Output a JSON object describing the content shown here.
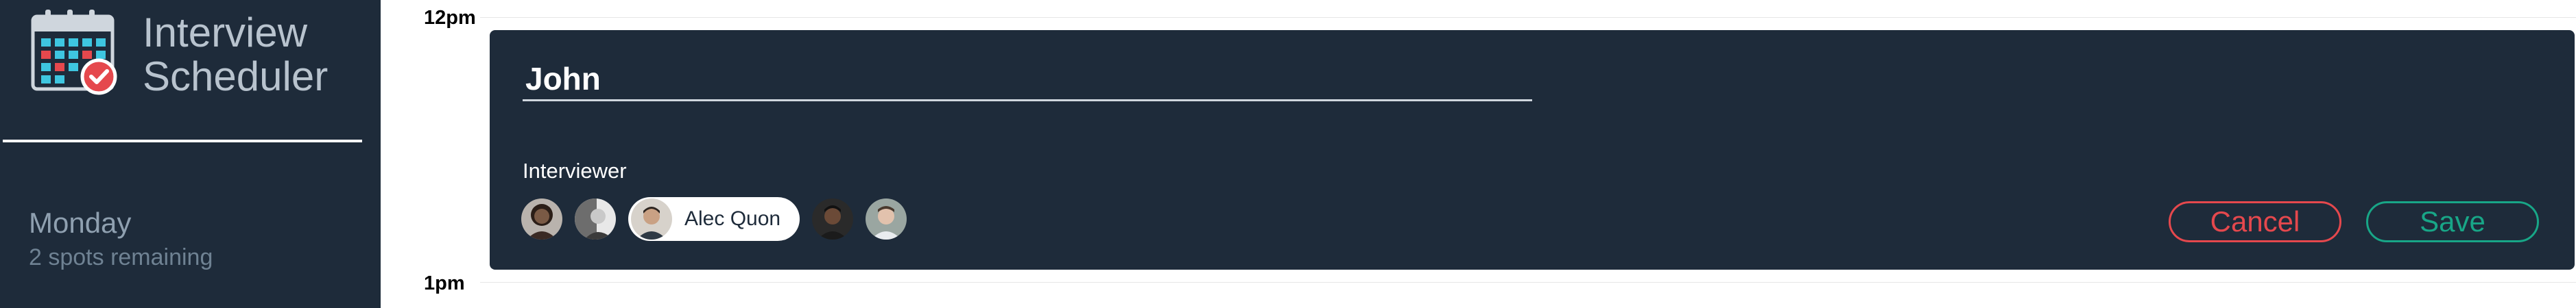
{
  "sidebar": {
    "logo_icon": "calendar-check-icon",
    "app_title_line1": "Interview",
    "app_title_line2": "Scheduler",
    "day": "Monday",
    "spots": "2 spots remaining"
  },
  "timeline": {
    "start_label": "12pm",
    "end_label": "1pm"
  },
  "card": {
    "name_value": "John",
    "interviewer_label": "Interviewer",
    "interviewers": [
      {
        "icon": "avatar-icon"
      },
      {
        "icon": "avatar-icon"
      },
      {
        "icon": "avatar-icon",
        "name": "Alec Quon",
        "selected": true
      },
      {
        "icon": "avatar-icon"
      },
      {
        "icon": "avatar-icon"
      }
    ],
    "cancel_label": "Cancel",
    "save_label": "Save"
  },
  "colors": {
    "sidebar_bg": "#1e2b3a",
    "card_bg": "#1e2b3a",
    "cancel": "#e5484d",
    "save": "#18a687"
  }
}
